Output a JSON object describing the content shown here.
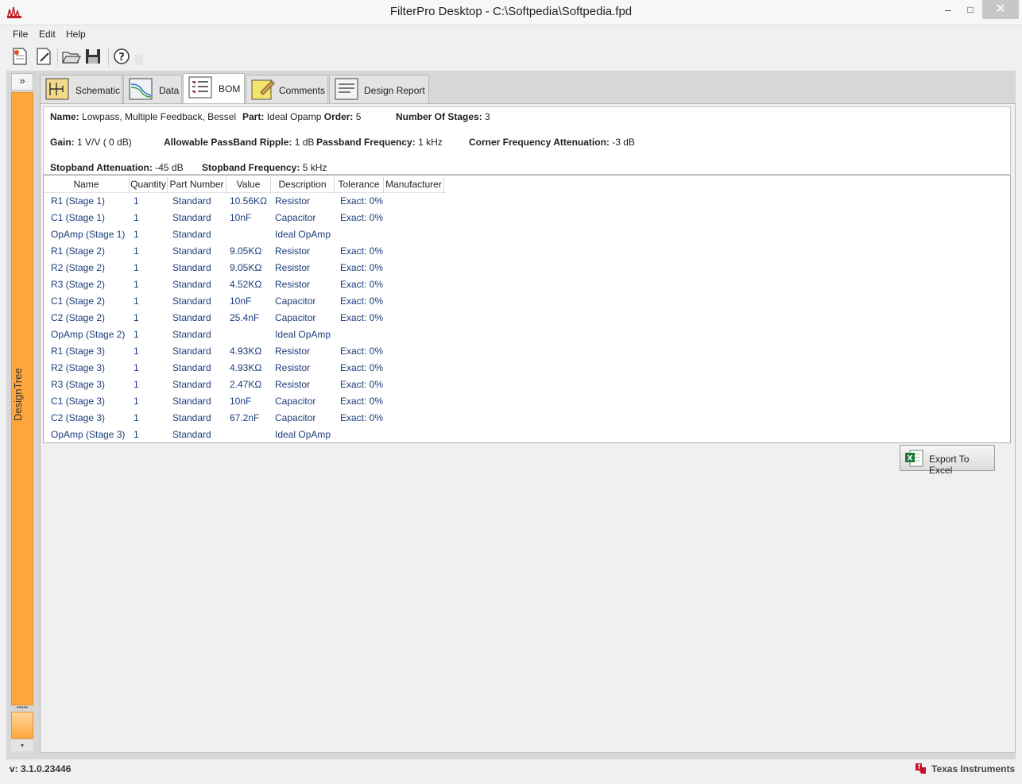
{
  "window": {
    "title": "FilterPro Desktop - C:\\Softpedia\\Softpedia.fpd",
    "minimize": "–",
    "maximize": "□",
    "close": "✕"
  },
  "menu": [
    "File",
    "Edit",
    "Help"
  ],
  "toolbar": {
    "icons": [
      "new-design-icon",
      "edit-design-icon",
      "open-folder-icon",
      "save-icon",
      "help-icon"
    ]
  },
  "sidebar": {
    "expand_glyph": "»",
    "label": "DesignTree",
    "grip": "•••••",
    "scroll_down": "▾",
    "accent": "#ffa63d"
  },
  "tabs": [
    {
      "label": "Schematic",
      "icon": "schematic-icon"
    },
    {
      "label": "Data",
      "icon": "data-chart-icon"
    },
    {
      "label": "BOM",
      "icon": "bom-list-icon",
      "active": true
    },
    {
      "label": "Comments",
      "icon": "comments-note-icon"
    },
    {
      "label": "Design Report",
      "icon": "design-report-icon"
    }
  ],
  "summary": {
    "name_label": "Name:",
    "name_value": "Lowpass, Multiple Feedback, Bessel",
    "part_label": "Part:",
    "part_value": "Ideal Opamp",
    "order_label": "Order:",
    "order_value": "5",
    "stages_label": "Number Of Stages:",
    "stages_value": "3",
    "gain_label": "Gain:",
    "gain_value": "1 V/V ( 0 dB)",
    "ripple_label": "Allowable PassBand Ripple:",
    "ripple_value": "1 dB",
    "passband_label": "Passband Frequency:",
    "passband_value": "1 kHz",
    "corner_label": "Corner Frequency Attenuation:",
    "corner_value": "-3 dB",
    "stopatt_label": "Stopband Attenuation:",
    "stopatt_value": "-45 dB",
    "stopfreq_label": "Stopband Frequency:",
    "stopfreq_value": "5 kHz"
  },
  "bom": {
    "columns": [
      "Name",
      "Quantity",
      "Part Number",
      "Value",
      "Description",
      "Tolerance",
      "Manufacturer"
    ],
    "rows": [
      [
        "R1 (Stage 1)",
        "1",
        "Standard",
        "10.56KΩ",
        "Resistor",
        "Exact: 0%"
      ],
      [
        "C1 (Stage 1)",
        "1",
        "Standard",
        "10nF",
        "Capacitor",
        "Exact: 0%"
      ],
      [
        "OpAmp (Stage 1)",
        "1",
        "Standard",
        "",
        "Ideal OpAmp",
        ""
      ],
      [
        "R1 (Stage 2)",
        "1",
        "Standard",
        "9.05KΩ",
        "Resistor",
        "Exact: 0%"
      ],
      [
        "R2 (Stage 2)",
        "1",
        "Standard",
        "9.05KΩ",
        "Resistor",
        "Exact: 0%"
      ],
      [
        "R3 (Stage 2)",
        "1",
        "Standard",
        "4.52KΩ",
        "Resistor",
        "Exact: 0%"
      ],
      [
        "C1 (Stage 2)",
        "1",
        "Standard",
        "10nF",
        "Capacitor",
        "Exact: 0%"
      ],
      [
        "C2 (Stage 2)",
        "1",
        "Standard",
        "25.4nF",
        "Capacitor",
        "Exact: 0%"
      ],
      [
        "OpAmp (Stage 2)",
        "1",
        "Standard",
        "",
        "Ideal OpAmp",
        ""
      ],
      [
        "R1 (Stage 3)",
        "1",
        "Standard",
        "4.93KΩ",
        "Resistor",
        "Exact: 0%"
      ],
      [
        "R2 (Stage 3)",
        "1",
        "Standard",
        "4.93KΩ",
        "Resistor",
        "Exact: 0%"
      ],
      [
        "R3 (Stage 3)",
        "1",
        "Standard",
        "2.47KΩ",
        "Resistor",
        "Exact: 0%"
      ],
      [
        "C1 (Stage 3)",
        "1",
        "Standard",
        "10nF",
        "Capacitor",
        "Exact: 0%"
      ],
      [
        "C2 (Stage 3)",
        "1",
        "Standard",
        "67.2nF",
        "Capacitor",
        "Exact: 0%"
      ],
      [
        "OpAmp (Stage 3)",
        "1",
        "Standard",
        "",
        "Ideal OpAmp",
        ""
      ]
    ]
  },
  "export": {
    "label": "Export To Excel",
    "icon": "excel-icon"
  },
  "status": {
    "version": "v: 3.1.0.23446",
    "vendor": "Texas Instruments"
  }
}
